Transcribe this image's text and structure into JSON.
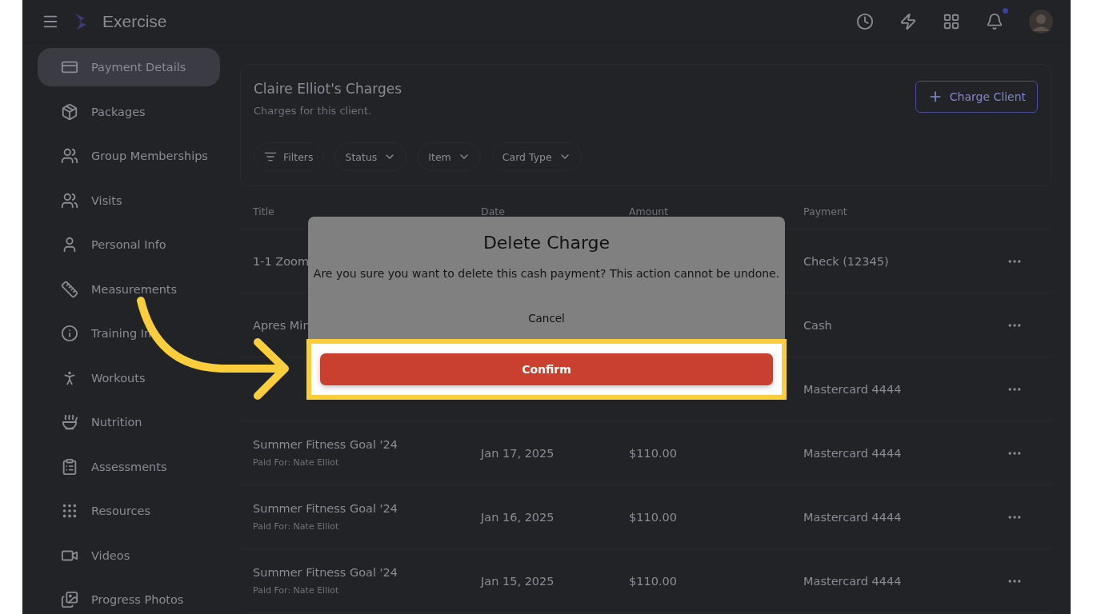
{
  "app": {
    "title": "Exercise",
    "notifications_unread": true
  },
  "sidebar": {
    "items": [
      {
        "label": "Payment Details",
        "selected": true
      },
      {
        "label": "Packages",
        "selected": false
      },
      {
        "label": "Group Memberships",
        "selected": false
      },
      {
        "label": "Visits",
        "selected": false
      },
      {
        "label": "Personal Info",
        "selected": false
      },
      {
        "label": "Measurements",
        "selected": false
      },
      {
        "label": "Training In",
        "selected": false
      },
      {
        "label": "Workouts",
        "selected": false
      },
      {
        "label": "Nutrition",
        "selected": false
      },
      {
        "label": "Assessments",
        "selected": false
      },
      {
        "label": "Resources",
        "selected": false
      },
      {
        "label": "Videos",
        "selected": false
      },
      {
        "label": "Progress Photos",
        "selected": false
      }
    ]
  },
  "charges": {
    "title": "Claire Elliot's Charges",
    "subtitle": "Charges for this client.",
    "action": "Charge Client",
    "filters": [
      {
        "label": "Filters",
        "kind": "icon"
      },
      {
        "label": "Status",
        "kind": "dropdown"
      },
      {
        "label": "Item",
        "kind": "dropdown"
      },
      {
        "label": "Card Type",
        "kind": "dropdown"
      }
    ],
    "columns": [
      "Title",
      "Date",
      "Amount",
      "Payment"
    ],
    "rows": [
      {
        "title": "1-1 Zoom",
        "payment": "Check (12345)"
      },
      {
        "title": "Apres Min",
        "payment": "Cash"
      },
      {
        "payment": "Mastercard 4444"
      },
      {
        "title": "Summer Fitness Goal '24",
        "paid_for": "Paid For: Nate Elliot",
        "date": "Jan 17, 2025",
        "amount": "$110.00",
        "payment": "Mastercard 4444"
      },
      {
        "title": "Summer Fitness Goal '24",
        "paid_for": "Paid For: Nate Elliot",
        "date": "Jan 16, 2025",
        "amount": "$110.00",
        "payment": "Mastercard 4444"
      },
      {
        "title": "Summer Fitness Goal '24",
        "paid_for": "Paid For: Nate Elliot",
        "date": "Jan 15, 2025",
        "amount": "$110.00",
        "payment": "Mastercard 4444"
      }
    ]
  },
  "dialog": {
    "title": "Delete Charge",
    "message": "Are you sure you want to delete this cash payment? This action cannot be undone.",
    "cancel": "Cancel",
    "confirm": "Confirm",
    "confirm_highlighted": true
  }
}
